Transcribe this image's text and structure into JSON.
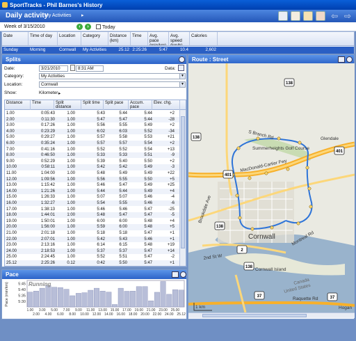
{
  "window": {
    "title": "SportTracks - Phil Barnes's History"
  },
  "appbar": {
    "title": "Daily activity",
    "breadcrumb": "My Activities",
    "crumb_arrow": "▸"
  },
  "weekbar": {
    "label": "Week of 3/15/2010",
    "today_label": "Today"
  },
  "activity_table": {
    "headers": [
      "Date",
      "Time of day",
      "Location",
      "Category",
      "Distance (km)",
      "Time",
      "Avg. pace (min/km)",
      "Avg. speed (km/h)",
      "Calories"
    ],
    "row": [
      "Sunday",
      "Morning",
      "Cornwall",
      "My Activities",
      "25.12",
      "2:25:26",
      "5:47",
      "10.4",
      "2,602"
    ]
  },
  "splits_panel": {
    "title": "Splits",
    "date_label": "Date:",
    "date_value": "3/21/2010",
    "time_value": "8:31 AM",
    "data_label": "Data:",
    "category_label": "Category:",
    "category_value": "My Activities",
    "location_label": "Location:",
    "location_value": "Cornwall",
    "show_label": "Show:",
    "show_value": "Kilometer",
    "columns": [
      "Distance",
      "Time",
      "Split distance",
      "Split time",
      "Split pace",
      "Accum. pace",
      "Elev. chg."
    ],
    "rows": [
      [
        "1.00",
        "0:05:43",
        "1.00",
        "5:43",
        "5:44",
        "5:44",
        "+2"
      ],
      [
        "2.00",
        "0:11:30",
        "1.00",
        "5:47",
        "5:47",
        "5:44",
        "-28"
      ],
      [
        "3.00",
        "0:17:26",
        "1.00",
        "5:56",
        "5:55",
        "5:49",
        "+2"
      ],
      [
        "4.00",
        "0:23:29",
        "1.00",
        "6:02",
        "6:03",
        "5:52",
        "-34"
      ],
      [
        "5.00",
        "0:29:27",
        "1.00",
        "5:57",
        "5:58",
        "5:53",
        "+21"
      ],
      [
        "6.00",
        "0:35:24",
        "1.00",
        "5:57",
        "5:57",
        "5:54",
        "+2"
      ],
      [
        "7.00",
        "0:41:16",
        "1.00",
        "5:52",
        "5:52",
        "5:54",
        "+13"
      ],
      [
        "8.00",
        "0:46:50",
        "1.00",
        "5:33",
        "5:33",
        "5:51",
        "-9"
      ],
      [
        "9.00",
        "0:52:29",
        "1.00",
        "5:39",
        "5:40",
        "5:50",
        "+2"
      ],
      [
        "10.00",
        "0:58:11",
        "1.00",
        "5:42",
        "5:42",
        "5:49",
        "-3"
      ],
      [
        "11.00",
        "1:04:00",
        "1.00",
        "5:48",
        "5:49",
        "5:49",
        "+22"
      ],
      [
        "12.00",
        "1:09:56",
        "1.00",
        "5:56",
        "5:55",
        "5:50",
        "+5"
      ],
      [
        "13.00",
        "1:15:42",
        "1.00",
        "5:46",
        "5:47",
        "5:49",
        "+25"
      ],
      [
        "14.00",
        "1:21:26",
        "1.00",
        "5:44",
        "5:44",
        "5:49",
        "+4"
      ],
      [
        "15.00",
        "1:26:33",
        "1.00",
        "5:07",
        "5:07",
        "5:46",
        "-4"
      ],
      [
        "16.00",
        "1:32:27",
        "1.00",
        "5:54",
        "5:55",
        "5:46",
        "-6"
      ],
      [
        "17.00",
        "1:38:13",
        "1.00",
        "5:46",
        "5:46",
        "5:47",
        "-25"
      ],
      [
        "18.00",
        "1:44:01",
        "1:00",
        "5:48",
        "5:47",
        "5:47",
        "-5"
      ],
      [
        "19.00",
        "1:50:01",
        "1.00",
        "6:00",
        "6:00",
        "5:48",
        "+4"
      ],
      [
        "20.00",
        "1:56:00",
        "1.00",
        "5:59",
        "6:00",
        "5:48",
        "+5"
      ],
      [
        "21.00",
        "2:01:18",
        "1.00",
        "5:18",
        "5:18",
        "5:47",
        "+1"
      ],
      [
        "22.00",
        "2:07:01",
        "1.00",
        "5:42",
        "5:43",
        "5:46",
        "+1"
      ],
      [
        "23.00",
        "2:13:16",
        "1.00",
        "6:14",
        "6:15",
        "5:48",
        "+19"
      ],
      [
        "24.00",
        "2:18:53",
        "1.00",
        "5:37",
        "5:37",
        "5:47",
        "+14"
      ],
      [
        "25.00",
        "2:24:45",
        "1.00",
        "5:52",
        "5:51",
        "5:47",
        "-2"
      ],
      [
        "25.12",
        "2:25:26",
        "0.12",
        "0:42",
        "5:50",
        "5:47",
        "+1"
      ]
    ]
  },
  "pace_panel": {
    "title": "Pace",
    "overlay": "Running",
    "ylabel": "Pace (min/km)",
    "yticks": [
      "5:30",
      "5:35",
      "5:40",
      "5:45"
    ],
    "xticks": [
      "1.00",
      "3.00",
      "5.00",
      "7.00",
      "9.00",
      "11.00",
      "13.00",
      "15.00",
      "17.00",
      "19.00",
      "21.00",
      "23.00",
      "25.00"
    ],
    "xticks2": [
      "2.00",
      "4.00",
      "6.00",
      "8.00",
      "10.00",
      "12.00",
      "14.00",
      "16.00",
      "18.00",
      "20.00",
      "22.00",
      "24.00",
      "25.12"
    ]
  },
  "chart_data": {
    "type": "bar",
    "title": "",
    "ylabel": "Pace (min/km)",
    "categories": [
      "1.00",
      "2.00",
      "3.00",
      "4.00",
      "5.00",
      "6.00",
      "7.00",
      "8.00",
      "9.00",
      "10.00",
      "11.00",
      "12.00",
      "13.00",
      "14.00",
      "15.00",
      "16.00",
      "17.00",
      "18.00",
      "19.00",
      "20.00",
      "21.00",
      "22.00",
      "23.00",
      "24.00",
      "25.00",
      "25.12"
    ],
    "values": [
      5.73,
      5.78,
      5.92,
      6.05,
      5.97,
      5.95,
      5.87,
      5.55,
      5.67,
      5.7,
      5.82,
      5.92,
      5.78,
      5.73,
      5.12,
      5.92,
      5.77,
      5.78,
      6.0,
      6.0,
      5.3,
      5.72,
      6.25,
      5.62,
      5.85,
      5.83
    ],
    "ylim": [
      5.0,
      6.3
    ]
  },
  "route_panel": {
    "title": "Route : Street",
    "labels": {
      "sbranch": "S Branch Rd",
      "glendale": "Glendale",
      "summerheights": "Summerheights Golf Course",
      "macdonald": "MacDonald-Cartier Fwy",
      "brookdale": "Brookdale Ave",
      "cornwall": "Cornwall",
      "montreal": "Montreal Rd",
      "second": "2nd St W",
      "cornwall_island": "Cornwall Island",
      "canada": "Canada",
      "us": "United States",
      "raquette": "Raquette Rd",
      "hogan": "Hogan",
      "scale": "1 km"
    },
    "shields": [
      "138",
      "401",
      "401",
      "138",
      "138",
      "2",
      "138",
      "37",
      "37"
    ]
  },
  "colors": {
    "accent": "#2c63c8",
    "route": "#2e74d8",
    "highway": "#f7b02a",
    "water": "#99b3cc"
  }
}
